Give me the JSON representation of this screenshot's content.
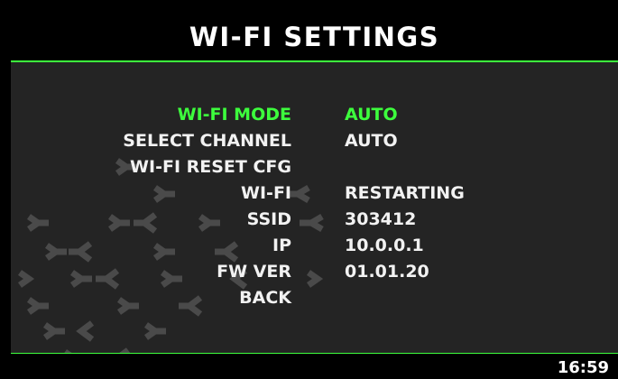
{
  "screen": {
    "title": "WI-FI SETTINGS",
    "accent_color": "#3dff3d"
  },
  "menu": {
    "selected_index": 0,
    "items": [
      {
        "label": "WI-FI MODE",
        "value": "AUTO"
      },
      {
        "label": "SELECT CHANNEL",
        "value": "AUTO"
      },
      {
        "label": "WI-FI RESET CFG",
        "value": ""
      },
      {
        "label": "WI-FI",
        "value": "RESTARTING"
      },
      {
        "label": "SSID",
        "value": "303412"
      },
      {
        "label": "IP",
        "value": "10.0.0.1"
      },
      {
        "label": "FW VER",
        "value": "01.01.20"
      },
      {
        "label": "BACK",
        "value": ""
      }
    ]
  },
  "footer": {
    "time": "16:59"
  }
}
